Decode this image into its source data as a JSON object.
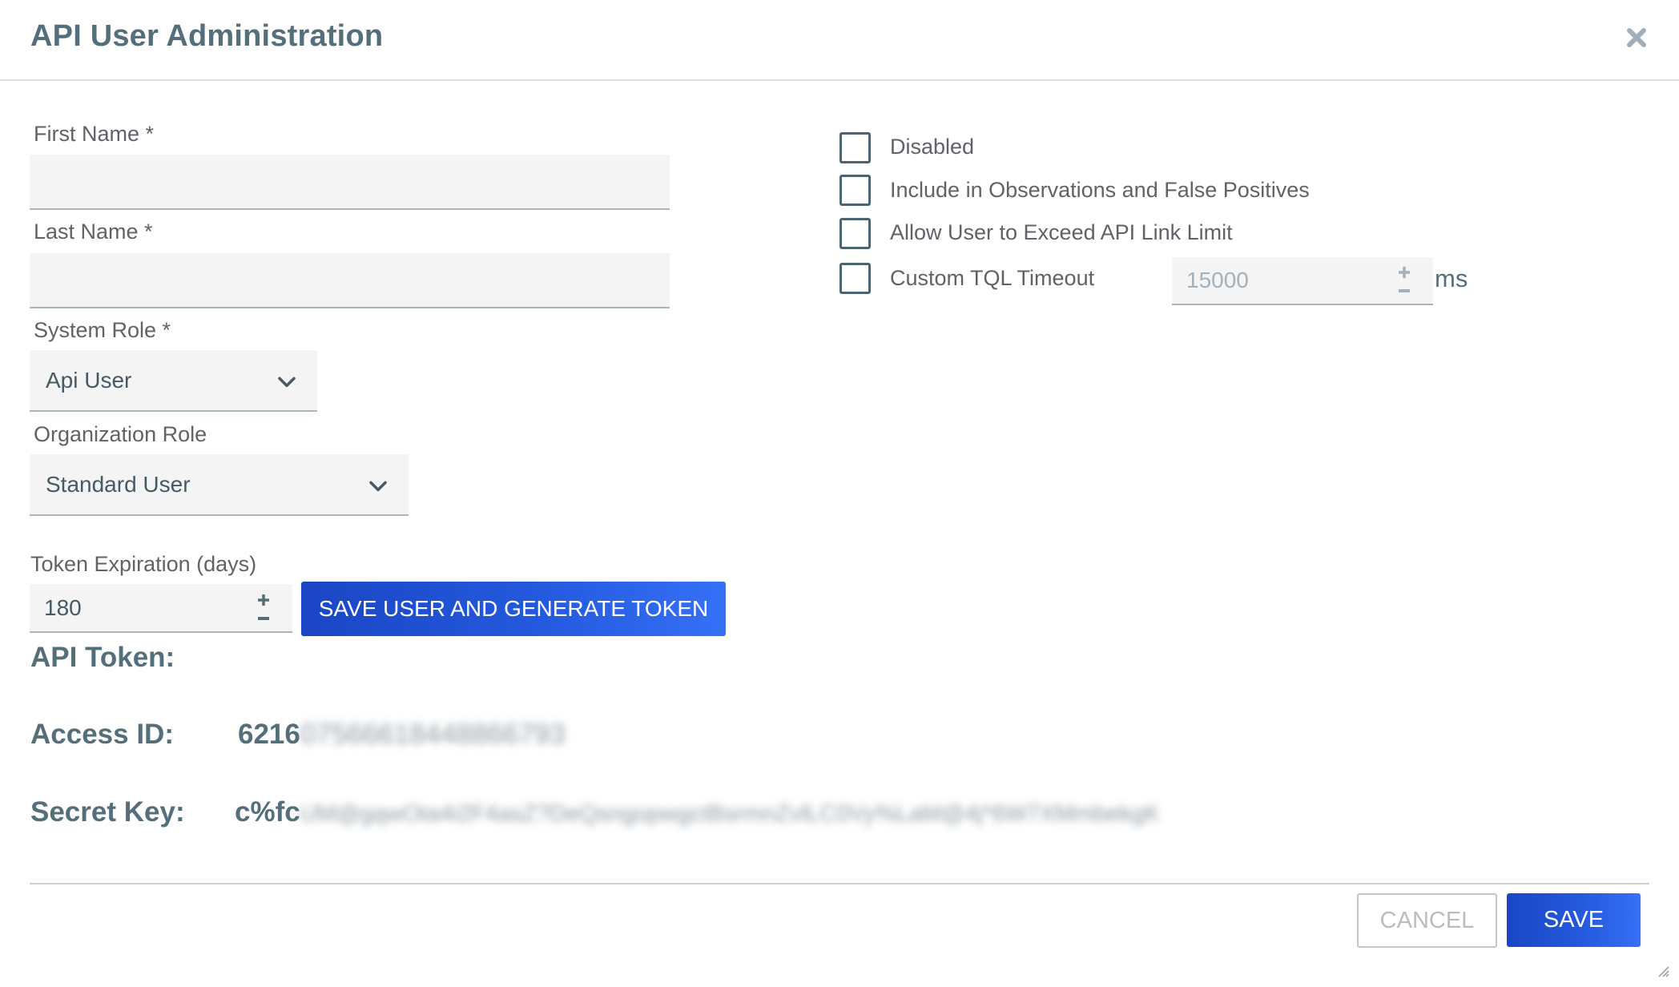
{
  "dialog": {
    "title": "API User Administration",
    "close_icon": "close-icon"
  },
  "form": {
    "first_name": {
      "label": "First Name *",
      "value": "",
      "placeholder": ""
    },
    "last_name": {
      "label": "Last Name *",
      "value": "",
      "placeholder": ""
    },
    "system_role": {
      "label": "System Role *",
      "selected": "Api User"
    },
    "organization_role": {
      "label": "Organization Role",
      "selected": "Standard User"
    },
    "token_expiration": {
      "label": "Token Expiration (days)",
      "value": "180"
    },
    "generate_button": "SAVE USER AND GENERATE TOKEN"
  },
  "options": {
    "checkboxes": [
      {
        "label": "Disabled",
        "checked": false
      },
      {
        "label": "Include in Observations and False Positives",
        "checked": false
      },
      {
        "label": "Allow User to Exceed API Link Limit",
        "checked": false
      },
      {
        "label": "Custom TQL Timeout",
        "checked": false
      }
    ],
    "tql_timeout": {
      "value": "15000",
      "unit": "ms",
      "disabled": true
    }
  },
  "token": {
    "heading": "API Token:",
    "access_id": {
      "label": "Access ID:",
      "visible_value": "6216",
      "redacted": "07566618448866793"
    },
    "secret_key": {
      "label": "Secret Key:",
      "visible_value": "c%fc",
      "redacted": "UM@gqwOta4i2F4asZ?DeQsngopwgctBsrmnZvlLC0Vy%LaM@4j*6W7XMmbekgK"
    }
  },
  "footer": {
    "cancel_label": "CANCEL",
    "save_label": "SAVE"
  },
  "colors": {
    "title": "#546e7a",
    "primary_start": "#1a46c4",
    "primary_end": "#3570f6",
    "input_bg": "#f4f4f4",
    "input_underline": "#a9b5bd"
  }
}
